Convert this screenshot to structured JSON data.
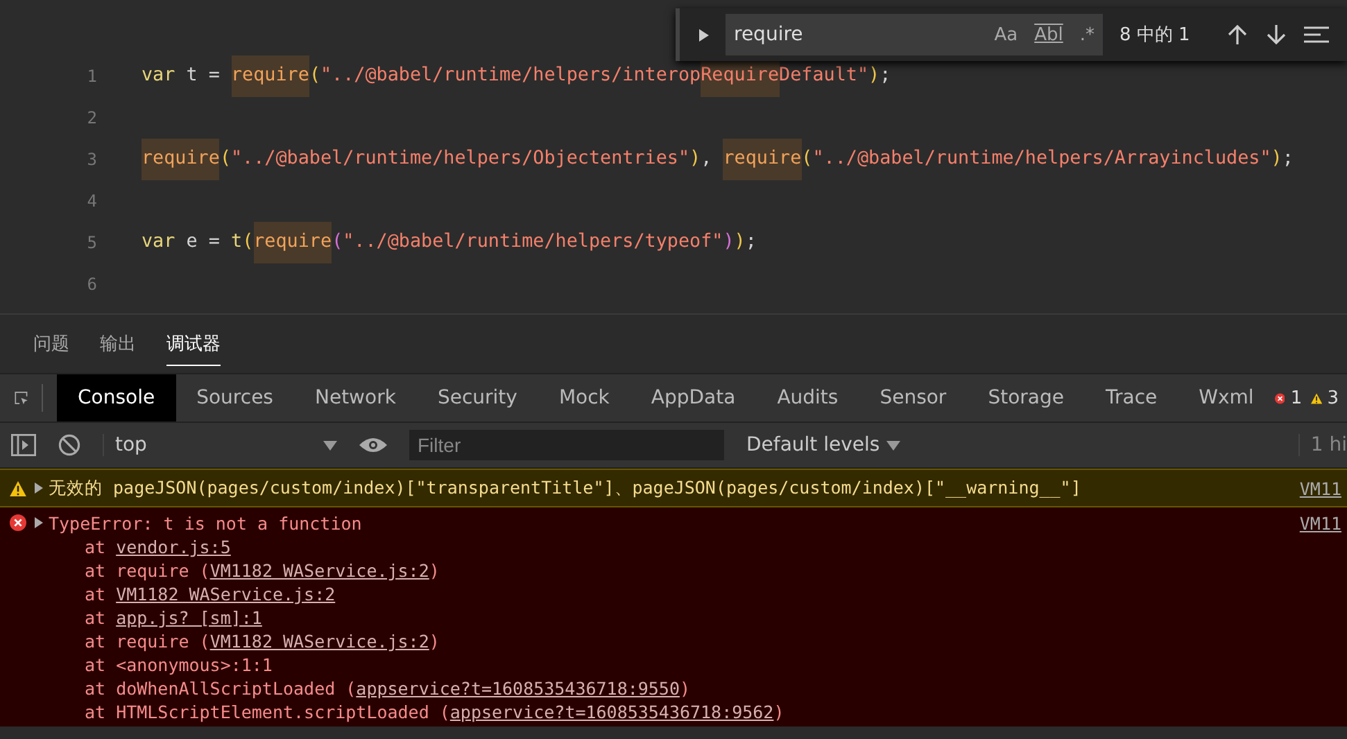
{
  "editor": {
    "lines": [
      {
        "number": "1",
        "tokens": [
          {
            "text": "var",
            "kind": "keyword"
          },
          {
            "text": " t = ",
            "kind": "plain"
          },
          {
            "text": "require",
            "kind": "match"
          },
          {
            "text": "(",
            "kind": "paren"
          },
          {
            "text": "\"../@babel/runtime/helpers/interop",
            "kind": "string"
          },
          {
            "text": "Require",
            "kind": "string-match"
          },
          {
            "text": "Default\"",
            "kind": "string"
          },
          {
            "text": ")",
            "kind": "paren"
          },
          {
            "text": ";",
            "kind": "plain"
          }
        ]
      },
      {
        "number": "2"
      },
      {
        "number": "3",
        "tokens": [
          {
            "text": "require",
            "kind": "match"
          },
          {
            "text": "(",
            "kind": "paren"
          },
          {
            "text": "\"../@babel/runtime/helpers/Objectentries\"",
            "kind": "string"
          },
          {
            "text": ")",
            "kind": "paren"
          },
          {
            "text": ", ",
            "kind": "plain"
          },
          {
            "text": "require",
            "kind": "match"
          },
          {
            "text": "(",
            "kind": "paren"
          },
          {
            "text": "\"../@babel/runtime/helpers/Arrayincludes\"",
            "kind": "string"
          },
          {
            "text": ")",
            "kind": "paren"
          },
          {
            "text": ";",
            "kind": "plain"
          }
        ]
      },
      {
        "number": "4"
      },
      {
        "number": "5",
        "tokens": [
          {
            "text": "var",
            "kind": "keyword"
          },
          {
            "text": " e = ",
            "kind": "plain"
          },
          {
            "text": "t",
            "kind": "keyword"
          },
          {
            "text": "(",
            "kind": "paren"
          },
          {
            "text": "require",
            "kind": "match"
          },
          {
            "text": "(",
            "kind": "paren2"
          },
          {
            "text": "\"../@babel/runtime/helpers/typeof\"",
            "kind": "string"
          },
          {
            "text": ")",
            "kind": "paren2"
          },
          {
            "text": ")",
            "kind": "paren"
          },
          {
            "text": ";",
            "kind": "plain"
          }
        ]
      },
      {
        "number": "6"
      }
    ],
    "find": {
      "value": "require",
      "count": "8 中的 1",
      "options": [
        "Aa",
        "Abl",
        ".*"
      ]
    }
  },
  "panel_tabs": [
    {
      "label": "问题",
      "selected": false
    },
    {
      "label": "输出",
      "selected": false
    },
    {
      "label": "调试器",
      "selected": true
    }
  ],
  "devtools_tabs": [
    {
      "label": "Console",
      "selected": true
    },
    {
      "label": "Sources",
      "selected": false
    },
    {
      "label": "Network",
      "selected": false
    },
    {
      "label": "Security",
      "selected": false
    },
    {
      "label": "Mock",
      "selected": false
    },
    {
      "label": "AppData",
      "selected": false
    },
    {
      "label": "Audits",
      "selected": false
    },
    {
      "label": "Sensor",
      "selected": false
    },
    {
      "label": "Storage",
      "selected": false
    },
    {
      "label": "Trace",
      "selected": false
    },
    {
      "label": "Wxml",
      "selected": false
    }
  ],
  "counters": {
    "errors": "1",
    "warnings": "3"
  },
  "toolbar": {
    "context": "top",
    "filter_placeholder": "Filter",
    "levels": "Default levels",
    "hidden": "1 hi"
  },
  "messages": [
    {
      "kind": "warning",
      "text": "无效的 pageJSON(pages/custom/index)[\"transparentTitle\"]、pageJSON(pages/custom/index)[\"__warning__\"]",
      "source": "VM11"
    },
    {
      "kind": "error",
      "text": "TypeError: t is not a function",
      "source": "VM11",
      "frames": [
        {
          "before": "at ",
          "link": "vendor.js:5"
        },
        {
          "before": "at require (",
          "link": "VM1182 WAService.js:2",
          "after": ")"
        },
        {
          "before": "at ",
          "link": "VM1182 WAService.js:2"
        },
        {
          "before": "at ",
          "link": "app.js? [sm]:1"
        },
        {
          "before": "at require (",
          "link": "VM1182 WAService.js:2",
          "after": ")"
        },
        {
          "before": "at <anonymous>:1:1"
        },
        {
          "before": "at doWhenAllScriptLoaded (",
          "link": "appservice?t=1608535436718:9550",
          "after": ")"
        },
        {
          "before": "at HTMLScriptElement.scriptLoaded (",
          "link": "appservice?t=1608535436718:9562",
          "after": ")"
        }
      ]
    }
  ]
}
